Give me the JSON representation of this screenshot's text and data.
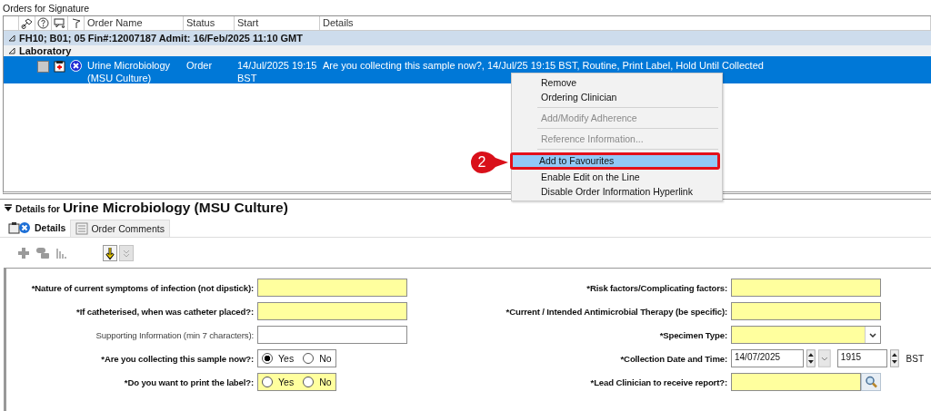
{
  "panel_title": "Orders for Signature",
  "table": {
    "columns": [
      "Order Name",
      "Status",
      "Start",
      "Details"
    ],
    "groups": [
      {
        "label": "FH10; B01; 05  Fin#:12007187  Admit: 16/Feb/2025 11:10 GMT",
        "expanded": true
      },
      {
        "label": "Laboratory",
        "expanded": true
      }
    ],
    "rows": [
      {
        "order_name": "Urine Microbiology (MSU Culture)",
        "status": "Order",
        "start": "14/Jul/2025 19:15 BST",
        "details": "Are you collecting this sample now?, 14/Jul/25 19:15 BST, Routine, Print Label, Hold Until Collected",
        "selected": true,
        "checked": false
      }
    ]
  },
  "context_menu": [
    {
      "kind": "item",
      "label": "Remove",
      "disabled": false,
      "selected": false
    },
    {
      "kind": "item",
      "label": "Ordering Clinician",
      "disabled": false,
      "selected": false
    },
    {
      "kind": "separator"
    },
    {
      "kind": "item",
      "label": "Add/Modify Adherence",
      "disabled": true,
      "selected": false
    },
    {
      "kind": "separator"
    },
    {
      "kind": "item",
      "label": "Reference Information...",
      "disabled": true,
      "selected": false
    },
    {
      "kind": "separator"
    },
    {
      "kind": "item",
      "label": "Add to Favourites",
      "disabled": false,
      "selected": true
    },
    {
      "kind": "item",
      "label": "Enable Edit on the Line",
      "disabled": false,
      "selected": false
    },
    {
      "kind": "item",
      "label": "Disable Order Information Hyperlink",
      "disabled": false,
      "selected": false
    }
  ],
  "callout": {
    "label": "2"
  },
  "details": {
    "prefix": "Details for",
    "title": "Urine Microbiology (MSU Culture)",
    "expanded": true,
    "tabs": [
      {
        "label": "Details",
        "selected": true
      },
      {
        "label": "Order Comments",
        "selected": false
      }
    ],
    "left_fields": [
      {
        "label": "*Nature of current symptoms of infection (not dipstick):",
        "kind": "text",
        "required": true,
        "highlighted": true
      },
      {
        "label": "*If catheterised, when was catheter placed?:",
        "kind": "text",
        "required": true,
        "highlighted": true
      },
      {
        "label": "Supporting Information (min 7 characters):",
        "kind": "text",
        "required": false,
        "highlighted": false
      },
      {
        "label": "*Are you collecting this sample now?:",
        "kind": "radio",
        "required": true,
        "highlighted": false,
        "options": [
          {
            "label": "Yes",
            "selected": true
          },
          {
            "label": "No",
            "selected": false
          }
        ]
      },
      {
        "label": "*Do you want to print the label?:",
        "kind": "radio",
        "required": true,
        "highlighted": true,
        "options": [
          {
            "label": "Yes",
            "selected": false
          },
          {
            "label": "No",
            "selected": false
          }
        ]
      }
    ],
    "right_fields": [
      {
        "label": "*Risk factors/Complicating factors:",
        "kind": "text",
        "required": true,
        "highlighted": true
      },
      {
        "label": "*Current / Intended Antimicrobial Therapy (be specific):",
        "kind": "text",
        "required": true,
        "highlighted": true
      },
      {
        "label": "*Specimen Type:",
        "kind": "dropdown",
        "required": true,
        "highlighted": true
      },
      {
        "label": "*Collection Date and Time:",
        "kind": "datetime",
        "required": true,
        "highlighted": false,
        "date": "14/07/2025",
        "time": "1915",
        "zone": "BST"
      },
      {
        "label": "*Lead Clinician to receive report?:",
        "kind": "lookup",
        "required": true,
        "highlighted": true
      }
    ]
  }
}
